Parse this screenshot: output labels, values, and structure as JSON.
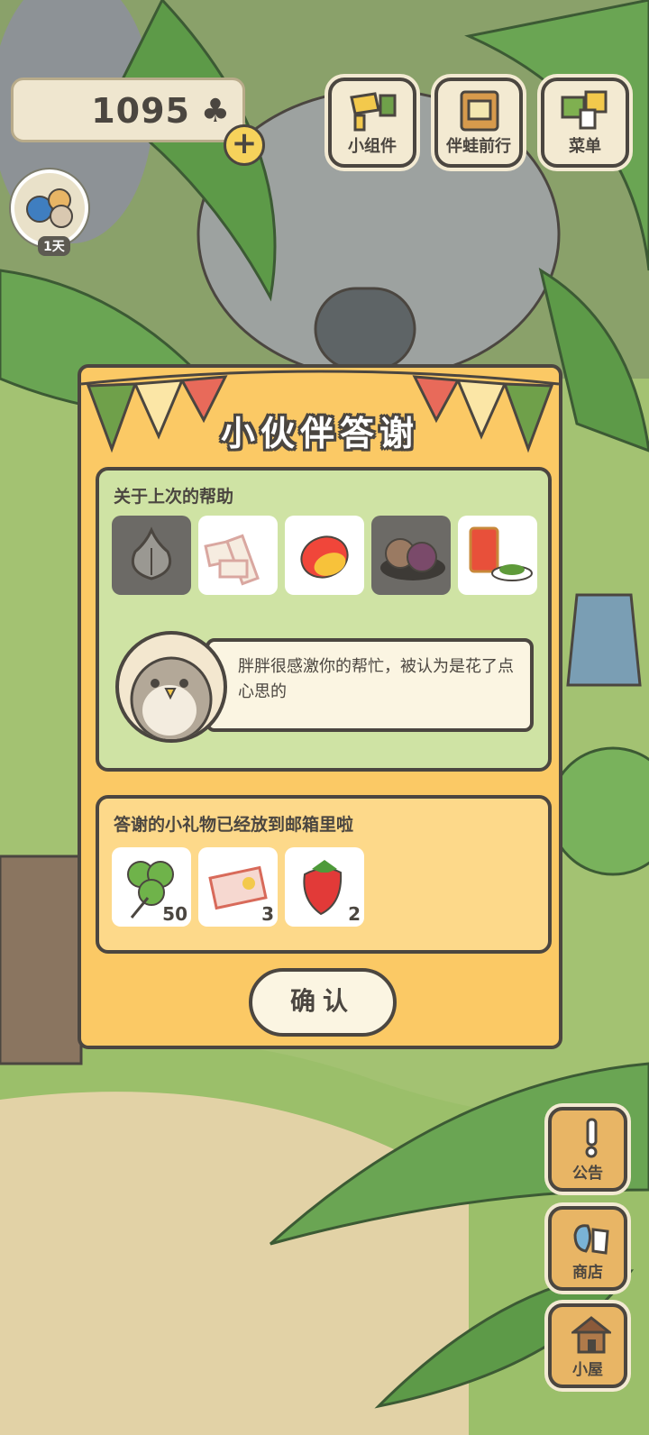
{
  "hud": {
    "clover_count": "1095",
    "clover_symbol": "♣",
    "add_label": "+",
    "buttons": [
      {
        "label": "小组件",
        "icon": "widget-icon"
      },
      {
        "label": "伴蛙前行",
        "icon": "frog-journey-icon"
      },
      {
        "label": "菜单",
        "icon": "menu-icon"
      }
    ],
    "day_badge": "1天"
  },
  "side_buttons": [
    {
      "label": "公告",
      "icon": "notice-icon"
    },
    {
      "label": "商店",
      "icon": "shop-icon"
    },
    {
      "label": "小屋",
      "icon": "house-icon"
    }
  ],
  "dialog": {
    "title": "小伙伴答谢",
    "help_header": "关于上次的帮助",
    "help_items": [
      {
        "icon": "garlic-icon",
        "dim": true
      },
      {
        "icon": "nougat-candy-icon",
        "dim": false
      },
      {
        "icon": "mango-icon",
        "dim": false
      },
      {
        "icon": "taro-pastry-icon",
        "dim": true
      },
      {
        "icon": "tea-can-icon",
        "dim": false
      }
    ],
    "message": "胖胖很感激你的帮忙，被认为是花了点心思的",
    "gift_header": "答谢的小礼物已经放到邮箱里啦",
    "gifts": [
      {
        "icon": "clover-icon",
        "qty": "50"
      },
      {
        "icon": "ticket-icon",
        "qty": "3"
      },
      {
        "icon": "strawberry-icon",
        "qty": "2"
      }
    ],
    "confirm_label": "确认"
  },
  "colors": {
    "outline": "#4b4640",
    "dialog_bg": "#fbc965",
    "panel_green": "#cfe3a4",
    "panel_yellow": "#fdd98a"
  }
}
